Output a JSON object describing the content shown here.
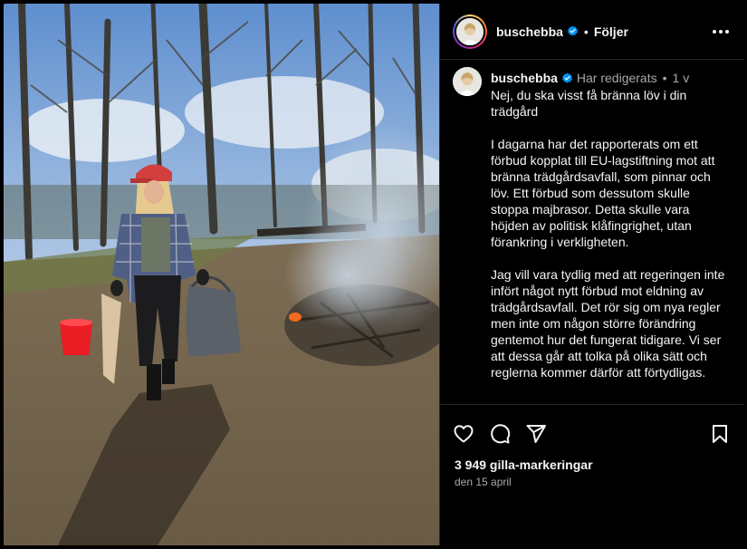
{
  "post": {
    "username": "buschebba",
    "follow_label": "Följer",
    "edited_label": "Har redigerats",
    "time_ago": "1 v",
    "caption_paragraphs": [
      "Nej, du ska visst få bränna löv i din trädgård",
      "I dagarna har det rapporterats om ett förbud kopplat till EU-lagstiftning mot att bränna trädgårdsavfall, som pinnar och löv. Ett förbud som dessutom skulle stoppa majbrasor. Detta skulle vara höjden av politisk klåfingrighet, utan förankring i verkligheten.",
      "Jag vill vara tydlig med att regeringen inte infört något nytt förbud mot eldning av trädgårdsavfall. Det rör sig om nya regler men inte om någon större förändring gentemot hur det fungerat tidigare. Vi ser att dessa går att tolka på olika sätt och reglerna kommer därför att förtydligas."
    ],
    "likes": "3 949 gilla-markeringar",
    "date": "den 15 april"
  },
  "icons": {
    "like": "heart-icon",
    "comment": "comment-icon",
    "share": "share-icon",
    "save": "bookmark-icon",
    "more": "more-options-icon",
    "verified": "verified-badge-icon"
  },
  "colors": {
    "background": "#000000",
    "text": "#f5f5f5",
    "secondary_text": "#a8a8a8",
    "verified": "#0095f6",
    "divider": "#262626"
  }
}
